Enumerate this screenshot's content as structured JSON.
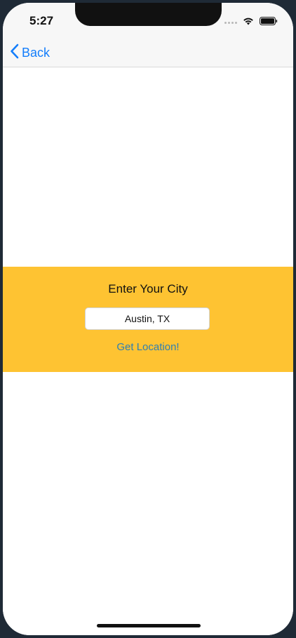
{
  "status_bar": {
    "time": "5:27",
    "icons": [
      "signal-dots-icon",
      "wifi-icon",
      "battery-icon"
    ]
  },
  "nav": {
    "back_label": "Back",
    "back_icon": "chevron-left-icon",
    "accent_color": "#147efb"
  },
  "panel": {
    "background_color": "#fec332",
    "title": "Enter Your City",
    "city_input_value": "Austin, TX",
    "get_location_label": "Get Location!"
  }
}
